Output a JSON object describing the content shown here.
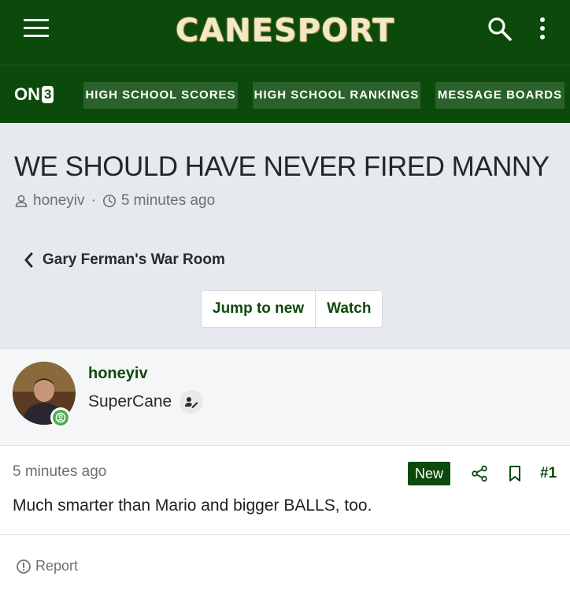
{
  "brand": {
    "name": "CANESPORT"
  },
  "nav": {
    "logo": {
      "text": "ON",
      "number": "3"
    },
    "items": [
      {
        "label": "HIGH SCHOOL SCORES"
      },
      {
        "label": "HIGH SCHOOL RANKINGS"
      },
      {
        "label": "MESSAGE BOARDS"
      }
    ]
  },
  "thread": {
    "title": "WE SHOULD HAVE NEVER FIRED MANNY",
    "author": "honeyiv",
    "time": "5 minutes ago",
    "forum": "Gary Ferman's War Room",
    "jump_label": "Jump to new",
    "watch_label": "Watch"
  },
  "user": {
    "name": "honeyiv",
    "title": "SuperCane"
  },
  "post": {
    "time": "5 minutes ago",
    "badge": "New",
    "number": "#1",
    "body": "Much smarter than Mario and bigger BALLS, too.",
    "report_label": "Report"
  },
  "colors": {
    "header_green": "#0b4a0b",
    "nav_pill": "#2b612b",
    "brand_gold": "#f3e8c8",
    "online_green": "#4caf50"
  }
}
